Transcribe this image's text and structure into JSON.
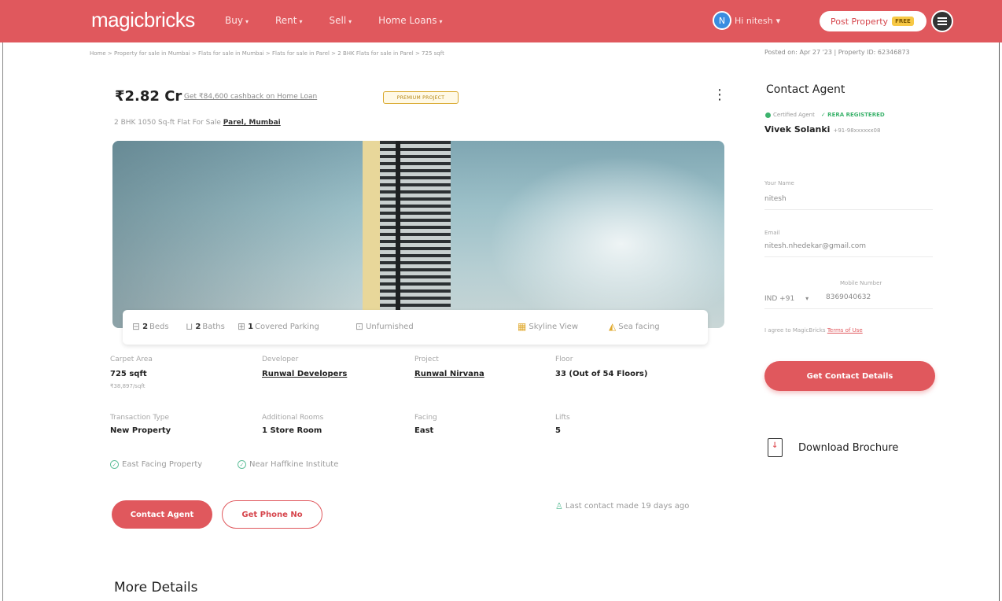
{
  "header": {
    "logo": "magicbricks",
    "nav": [
      {
        "label": "Buy"
      },
      {
        "label": "Rent"
      },
      {
        "label": "Sell"
      },
      {
        "label": "Home Loans"
      }
    ],
    "user_initial": "N",
    "user_name": "Hi nitesh",
    "post_property": "Post Property",
    "free_badge": "FREE"
  },
  "breadcrumb": "Home > Property for sale in Mumbai > Flats for sale in Mumbai > Flats for sale in Parel > 2 BHK Flats for sale in Parel > 725 sqft",
  "posted": "Posted on: Apr 27 '23  |  Property ID: 62346873",
  "listing": {
    "price": "₹2.82 Cr",
    "cashback": "Get ₹84,600 cashback on Home Loan",
    "premium_badge": "PREMIUM PROJECT",
    "kebab": "⋮",
    "subtitle_prefix": "2 BHK 1050 Sq-ft Flat For Sale",
    "location": "Parel, Mumbai"
  },
  "amenities": [
    {
      "count": "2",
      "label": "Beds"
    },
    {
      "count": "2",
      "label": "Baths"
    },
    {
      "count": "1",
      "label": "Covered Parking"
    },
    {
      "count": "",
      "label": "Unfurnished"
    },
    {
      "count": "",
      "label": "Skyline View"
    },
    {
      "count": "",
      "label": "Sea facing"
    }
  ],
  "details": {
    "carpet_area_label": "Carpet Area",
    "carpet_area_value": "725 sqft",
    "carpet_area_sub": "₹38,897/sqft",
    "developer_label": "Developer",
    "developer_value": "Runwal Developers",
    "project_label": "Project",
    "project_value": "Runwal Nirvana",
    "floor_label": "Floor",
    "floor_value": "33 (Out of 54 Floors)",
    "transaction_label": "Transaction Type",
    "transaction_value": "New Property",
    "rooms_label": "Additional Rooms",
    "rooms_value": "1 Store Room",
    "facing_label": "Facing",
    "facing_value": "East",
    "lifts_label": "Lifts",
    "lifts_value": "5"
  },
  "features": [
    "East Facing Property",
    "Near Haffkine Institute"
  ],
  "actions": {
    "contact_agent": "Contact Agent",
    "get_phone": "Get Phone No",
    "last_contact": "Last contact made 19 days ago"
  },
  "more_details": "More Details",
  "contact_panel": {
    "title": "Contact Agent",
    "certified": "Certified Agent",
    "rera": "✓ RERA REGISTERED",
    "agent_name": "Vivek Solanki",
    "agent_phone": "+91-98xxxxxx08",
    "name_label": "Your Name",
    "name_value": "nitesh",
    "email_label": "Email",
    "email_value": "nitesh.nhedekar@gmail.com",
    "country_code": "IND +91",
    "mobile_label": "Mobile Number",
    "mobile_value": "8369040632",
    "terms_prefix": "I agree to MagicBricks",
    "terms_link": "Terms of Use",
    "get_details": "Get Contact Details",
    "brochure": "Download Brochure"
  }
}
